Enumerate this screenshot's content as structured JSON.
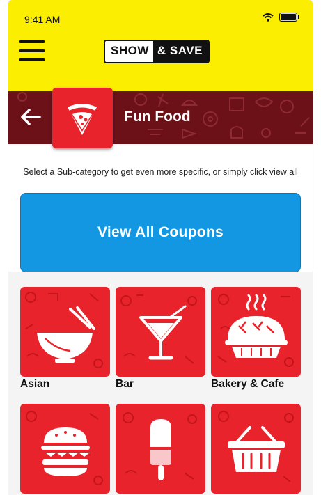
{
  "status_bar": {
    "time": "9:41 AM"
  },
  "header": {
    "logo_left": "SHOW",
    "logo_right": "& SAVE"
  },
  "banner": {
    "title": "Fun Food"
  },
  "instruction": "Select a Sub-category to get even more specific, or simply click view all",
  "view_all_label": "View All Coupons",
  "subcategories": [
    {
      "label": "Asian",
      "icon": "noodle-bowl-icon"
    },
    {
      "label": "Bar",
      "icon": "cocktail-glass-icon"
    },
    {
      "label": "Bakery & Cafe",
      "icon": "pie-icon"
    },
    {
      "label": "",
      "icon": "burger-icon"
    },
    {
      "label": "",
      "icon": "popsicle-icon"
    },
    {
      "label": "",
      "icon": "basket-icon"
    }
  ],
  "colors": {
    "header_bg": "#fcee00",
    "banner_bg": "#6d1119",
    "tile_bg": "#e8232b",
    "button_bg": "#1397e3"
  }
}
